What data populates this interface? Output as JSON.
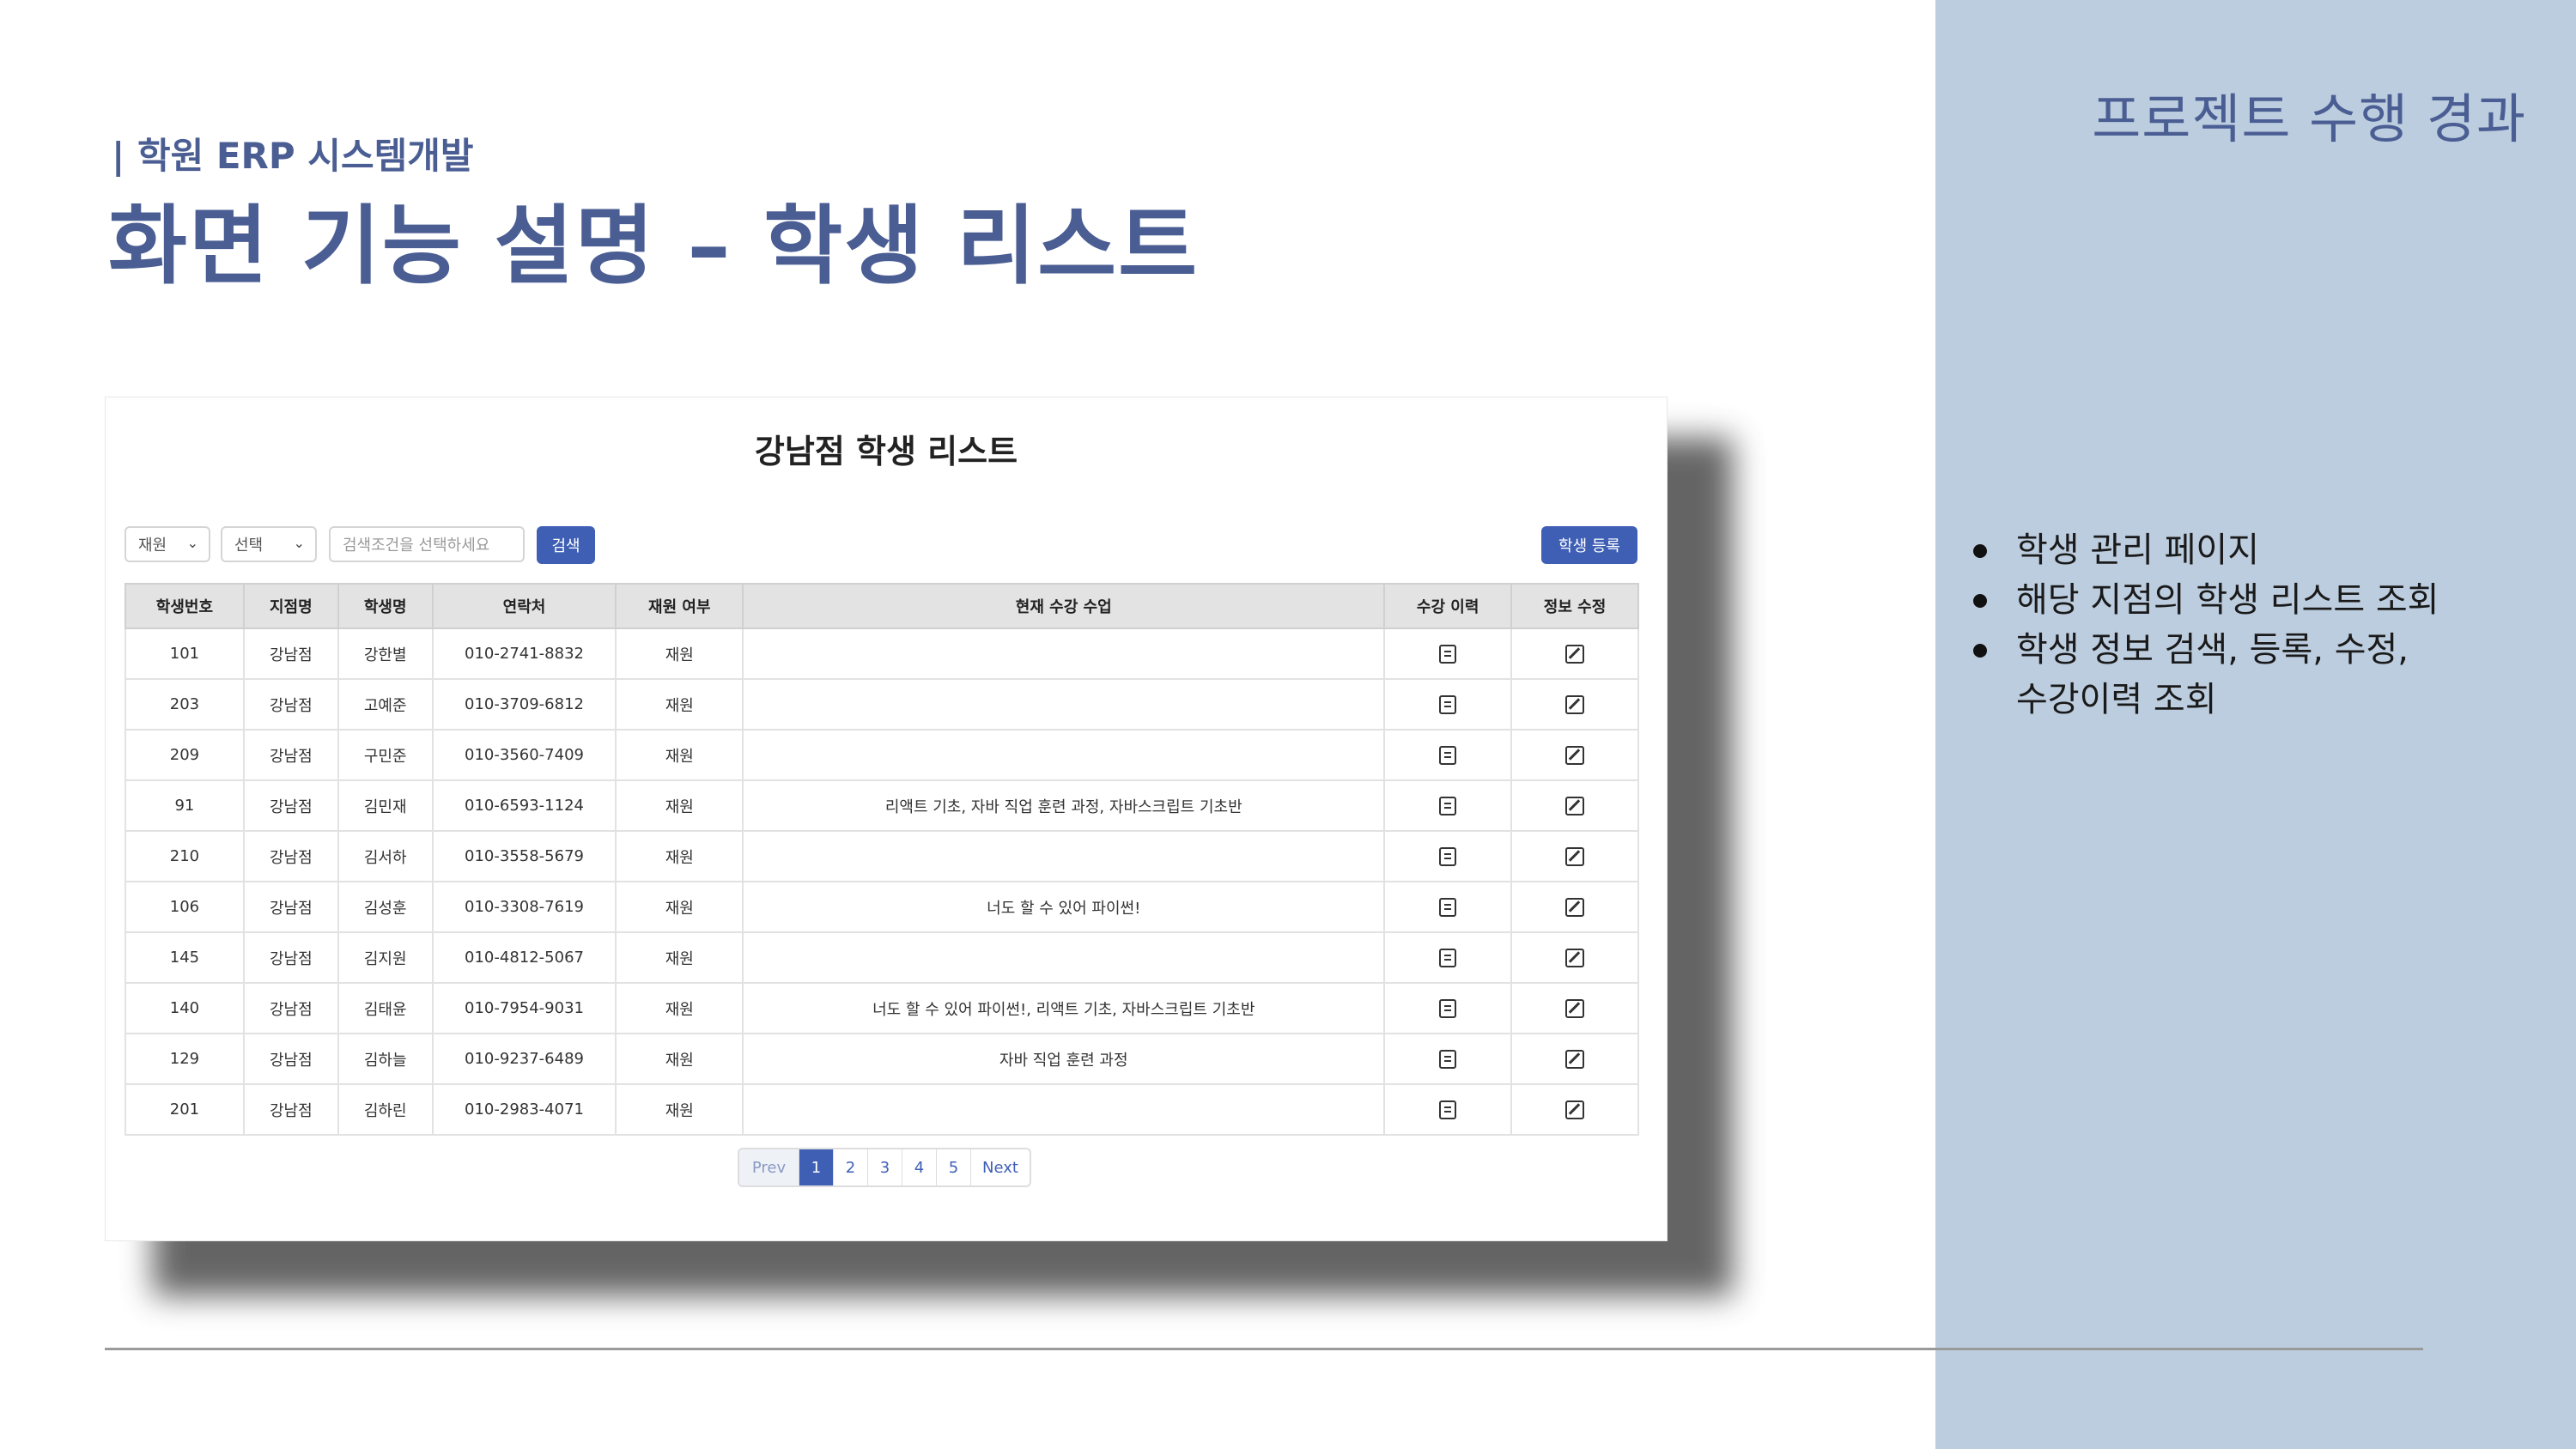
{
  "slide": {
    "subtitle": "| 학원 ERP 시스템개발",
    "title": "화면 기능 설명 – 학생 리스트",
    "panel_title": "프로젝트 수행 경과",
    "bullets": [
      "학생 관리 페이지",
      "해당 지점의 학생 리스트 조회",
      "학생 정보 검색, 등록, 수정,",
      "수강이력 조회"
    ]
  },
  "screen": {
    "title": "강남점 학생 리스트",
    "filter_status": "재원",
    "filter_field": "선택",
    "search_placeholder": "검색조건을 선택하세요",
    "search_button": "검색",
    "register_button": "학생 등록",
    "columns": [
      "학생번호",
      "지점명",
      "학생명",
      "연락처",
      "재원 여부",
      "현재 수강 수업",
      "수강 이력",
      "정보 수정"
    ],
    "rows": [
      {
        "id": "101",
        "branch": "강남점",
        "name": "강한별",
        "phone": "010-2741-8832",
        "status": "재원",
        "courses": ""
      },
      {
        "id": "203",
        "branch": "강남점",
        "name": "고예준",
        "phone": "010-3709-6812",
        "status": "재원",
        "courses": ""
      },
      {
        "id": "209",
        "branch": "강남점",
        "name": "구민준",
        "phone": "010-3560-7409",
        "status": "재원",
        "courses": ""
      },
      {
        "id": "91",
        "branch": "강남점",
        "name": "김민재",
        "phone": "010-6593-1124",
        "status": "재원",
        "courses": "리액트 기초, 자바 직업 훈련 과정, 자바스크립트 기초반"
      },
      {
        "id": "210",
        "branch": "강남점",
        "name": "김서하",
        "phone": "010-3558-5679",
        "status": "재원",
        "courses": ""
      },
      {
        "id": "106",
        "branch": "강남점",
        "name": "김성훈",
        "phone": "010-3308-7619",
        "status": "재원",
        "courses": "너도 할 수 있어 파이썬!"
      },
      {
        "id": "145",
        "branch": "강남점",
        "name": "김지원",
        "phone": "010-4812-5067",
        "status": "재원",
        "courses": ""
      },
      {
        "id": "140",
        "branch": "강남점",
        "name": "김태윤",
        "phone": "010-7954-9031",
        "status": "재원",
        "courses": "너도 할 수 있어 파이썬!, 리액트 기초, 자바스크립트 기초반"
      },
      {
        "id": "129",
        "branch": "강남점",
        "name": "김하늘",
        "phone": "010-9237-6489",
        "status": "재원",
        "courses": "자바 직업 훈련 과정"
      },
      {
        "id": "201",
        "branch": "강남점",
        "name": "김하린",
        "phone": "010-2983-4071",
        "status": "재원",
        "courses": ""
      }
    ],
    "pagination": {
      "prev": "Prev",
      "pages": [
        "1",
        "2",
        "3",
        "4",
        "5"
      ],
      "next": "Next"
    }
  }
}
